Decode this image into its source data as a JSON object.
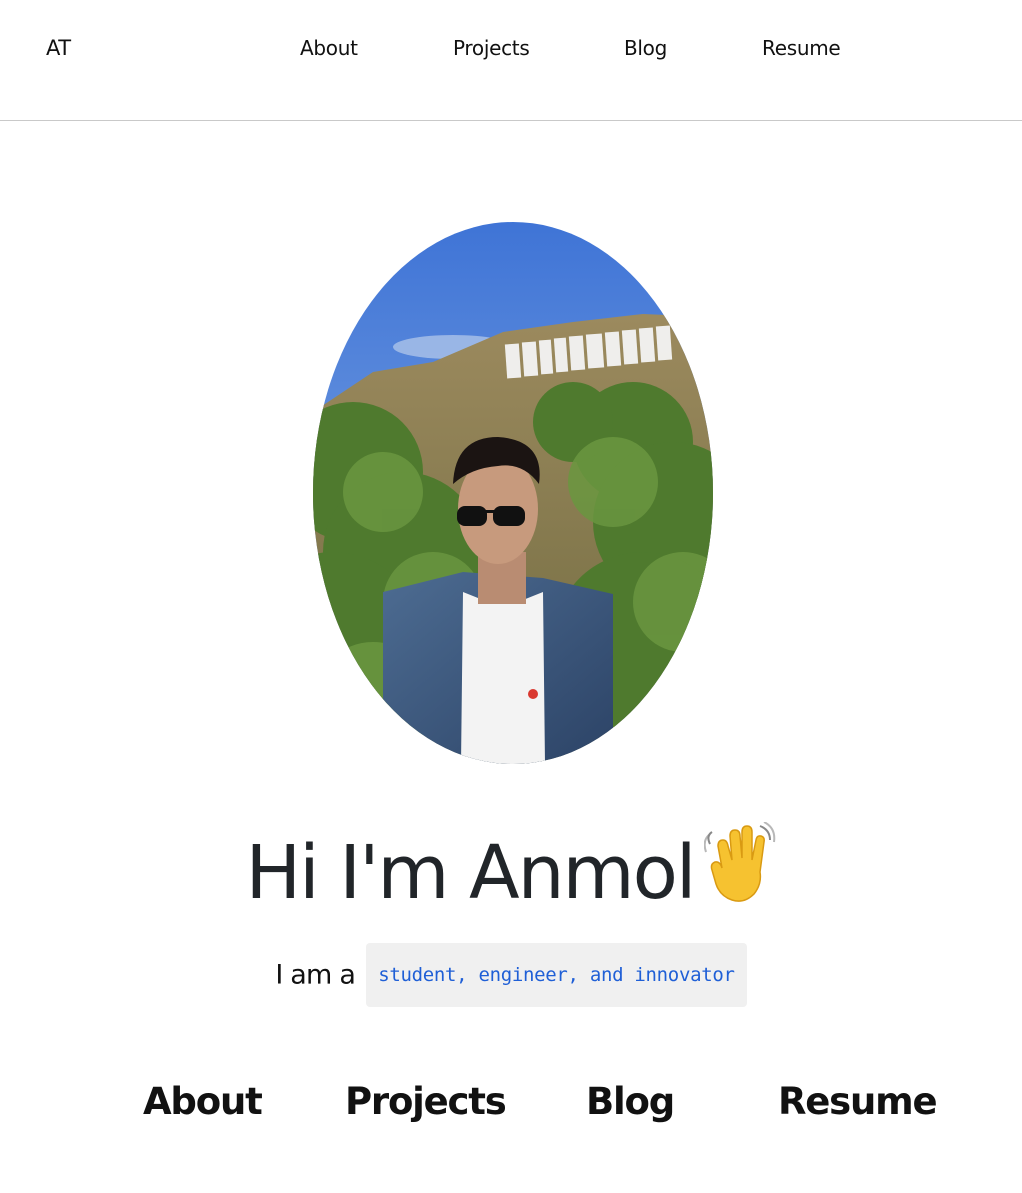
{
  "nav": {
    "brand": "AT",
    "links": [
      "About",
      "Projects",
      "Blog",
      "Resume"
    ]
  },
  "hero": {
    "title": "Hi I'm Anmol",
    "wave_icon": "waving-hand-icon",
    "tagline_prefix": "I am a",
    "roles": "student, engineer, and innovator"
  },
  "sections": [
    "About",
    "Projects",
    "Blog",
    "Resume"
  ],
  "colors": {
    "text": "#212529",
    "code_text": "#1f5fd6",
    "code_bg": "#f0f0f0",
    "divider": "#c9c9c9"
  }
}
